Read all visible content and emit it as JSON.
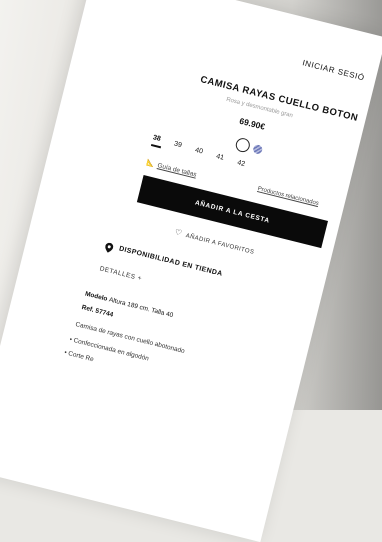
{
  "header": {
    "login_label": "INICIAR SESIÓ"
  },
  "product": {
    "title": "CAMISA RAYAS CUELLO BOTON",
    "subtitle": "Rosa y desmontable gran",
    "price": "69.90€"
  },
  "colors": {
    "swatch_1": "#ffffff",
    "swatch_2": "#6e79b8"
  },
  "sizes": [
    "38",
    "39",
    "40",
    "41",
    "42"
  ],
  "selected_size": "38",
  "links": {
    "size_guide": "Guía de tallas",
    "deliveries": "Productos relacionados"
  },
  "buttons": {
    "add_to_cart": "AÑADIR A LA CESTA",
    "add_favorites": "AÑADIR A FAVORITOS"
  },
  "store": {
    "availability": "DISPONIBILIDAD EN TIENDA"
  },
  "details": {
    "toggle": "DETALLES +",
    "model_label": "Modelo",
    "model_value": "Altura 189 cm. Talla 40",
    "ref": "Ref. 57744",
    "description": "Camisa de rayas con cuello abotonado",
    "bullet_1": "• Confeccionada en algodón",
    "bullet_2": "• Corte Re"
  }
}
